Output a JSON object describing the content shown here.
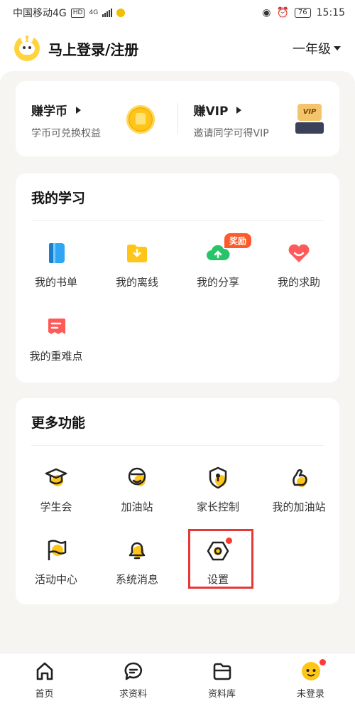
{
  "status_bar": {
    "carrier": "中国移动4G",
    "hd": "HD",
    "net": "4G",
    "battery": "76",
    "time": "15:15"
  },
  "header": {
    "login_text": "马上登录/注册",
    "grade": "一年级"
  },
  "earn": {
    "coin": {
      "title": "赚学币",
      "subtitle": "学币可兑换权益"
    },
    "vip": {
      "title": "赚VIP",
      "subtitle": "邀请同学可得VIP",
      "badge": "VIP"
    }
  },
  "study": {
    "title": "我的学习",
    "reward_badge": "奖励",
    "items": [
      {
        "label": "我的书单",
        "icon": "book-icon"
      },
      {
        "label": "我的离线",
        "icon": "offline-folder-icon"
      },
      {
        "label": "我的分享",
        "icon": "share-cloud-icon"
      },
      {
        "label": "我的求助",
        "icon": "help-heart-icon"
      },
      {
        "label": "我的重难点",
        "icon": "bookmark-note-icon"
      }
    ]
  },
  "more": {
    "title": "更多功能",
    "items": [
      {
        "label": "学生会",
        "icon": "graduation-cap-icon"
      },
      {
        "label": "加油站",
        "icon": "cheer-face-icon"
      },
      {
        "label": "家长控制",
        "icon": "parent-lock-icon"
      },
      {
        "label": "我的加油站",
        "icon": "muscle-arm-icon"
      },
      {
        "label": "活动中心",
        "icon": "flag-icon"
      },
      {
        "label": "系统消息",
        "icon": "bell-icon"
      },
      {
        "label": "设置",
        "icon": "settings-gear-icon"
      }
    ]
  },
  "bottom_nav": [
    {
      "label": "首页",
      "icon": "home-icon"
    },
    {
      "label": "求资料",
      "icon": "chat-bubble-icon"
    },
    {
      "label": "资料库",
      "icon": "folder-icon"
    },
    {
      "label": "未登录",
      "icon": "avatar-face-icon"
    }
  ],
  "colors": {
    "accent_yellow": "#ffc619",
    "badge_red": "#ff3b30",
    "highlight_red": "#e53935",
    "background": "#f6f5f2"
  }
}
